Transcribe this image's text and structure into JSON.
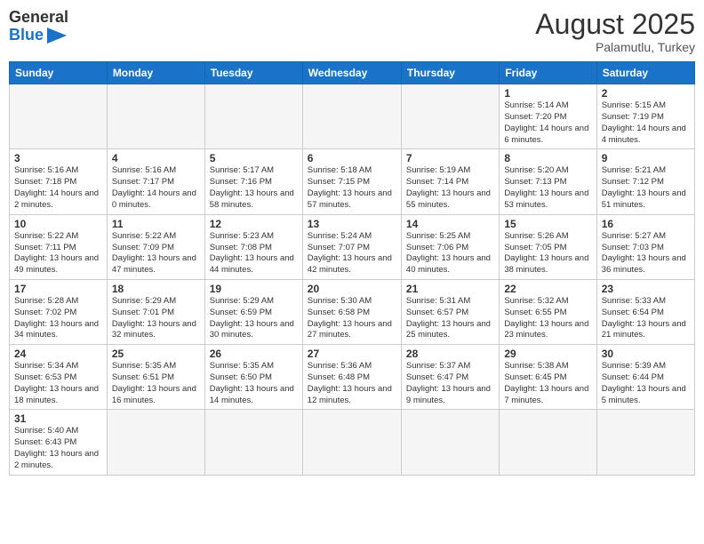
{
  "header": {
    "logo_general": "General",
    "logo_blue": "Blue",
    "month_year": "August 2025",
    "location": "Palamutlu, Turkey"
  },
  "weekdays": [
    "Sunday",
    "Monday",
    "Tuesday",
    "Wednesday",
    "Thursday",
    "Friday",
    "Saturday"
  ],
  "weeks": [
    [
      {
        "day": "",
        "info": ""
      },
      {
        "day": "",
        "info": ""
      },
      {
        "day": "",
        "info": ""
      },
      {
        "day": "",
        "info": ""
      },
      {
        "day": "",
        "info": ""
      },
      {
        "day": "1",
        "info": "Sunrise: 5:14 AM\nSunset: 7:20 PM\nDaylight: 14 hours\nand 6 minutes."
      },
      {
        "day": "2",
        "info": "Sunrise: 5:15 AM\nSunset: 7:19 PM\nDaylight: 14 hours\nand 4 minutes."
      }
    ],
    [
      {
        "day": "3",
        "info": "Sunrise: 5:16 AM\nSunset: 7:18 PM\nDaylight: 14 hours\nand 2 minutes."
      },
      {
        "day": "4",
        "info": "Sunrise: 5:16 AM\nSunset: 7:17 PM\nDaylight: 14 hours\nand 0 minutes."
      },
      {
        "day": "5",
        "info": "Sunrise: 5:17 AM\nSunset: 7:16 PM\nDaylight: 13 hours\nand 58 minutes."
      },
      {
        "day": "6",
        "info": "Sunrise: 5:18 AM\nSunset: 7:15 PM\nDaylight: 13 hours\nand 57 minutes."
      },
      {
        "day": "7",
        "info": "Sunrise: 5:19 AM\nSunset: 7:14 PM\nDaylight: 13 hours\nand 55 minutes."
      },
      {
        "day": "8",
        "info": "Sunrise: 5:20 AM\nSunset: 7:13 PM\nDaylight: 13 hours\nand 53 minutes."
      },
      {
        "day": "9",
        "info": "Sunrise: 5:21 AM\nSunset: 7:12 PM\nDaylight: 13 hours\nand 51 minutes."
      }
    ],
    [
      {
        "day": "10",
        "info": "Sunrise: 5:22 AM\nSunset: 7:11 PM\nDaylight: 13 hours\nand 49 minutes."
      },
      {
        "day": "11",
        "info": "Sunrise: 5:22 AM\nSunset: 7:09 PM\nDaylight: 13 hours\nand 47 minutes."
      },
      {
        "day": "12",
        "info": "Sunrise: 5:23 AM\nSunset: 7:08 PM\nDaylight: 13 hours\nand 44 minutes."
      },
      {
        "day": "13",
        "info": "Sunrise: 5:24 AM\nSunset: 7:07 PM\nDaylight: 13 hours\nand 42 minutes."
      },
      {
        "day": "14",
        "info": "Sunrise: 5:25 AM\nSunset: 7:06 PM\nDaylight: 13 hours\nand 40 minutes."
      },
      {
        "day": "15",
        "info": "Sunrise: 5:26 AM\nSunset: 7:05 PM\nDaylight: 13 hours\nand 38 minutes."
      },
      {
        "day": "16",
        "info": "Sunrise: 5:27 AM\nSunset: 7:03 PM\nDaylight: 13 hours\nand 36 minutes."
      }
    ],
    [
      {
        "day": "17",
        "info": "Sunrise: 5:28 AM\nSunset: 7:02 PM\nDaylight: 13 hours\nand 34 minutes."
      },
      {
        "day": "18",
        "info": "Sunrise: 5:29 AM\nSunset: 7:01 PM\nDaylight: 13 hours\nand 32 minutes."
      },
      {
        "day": "19",
        "info": "Sunrise: 5:29 AM\nSunset: 6:59 PM\nDaylight: 13 hours\nand 30 minutes."
      },
      {
        "day": "20",
        "info": "Sunrise: 5:30 AM\nSunset: 6:58 PM\nDaylight: 13 hours\nand 27 minutes."
      },
      {
        "day": "21",
        "info": "Sunrise: 5:31 AM\nSunset: 6:57 PM\nDaylight: 13 hours\nand 25 minutes."
      },
      {
        "day": "22",
        "info": "Sunrise: 5:32 AM\nSunset: 6:55 PM\nDaylight: 13 hours\nand 23 minutes."
      },
      {
        "day": "23",
        "info": "Sunrise: 5:33 AM\nSunset: 6:54 PM\nDaylight: 13 hours\nand 21 minutes."
      }
    ],
    [
      {
        "day": "24",
        "info": "Sunrise: 5:34 AM\nSunset: 6:53 PM\nDaylight: 13 hours\nand 18 minutes."
      },
      {
        "day": "25",
        "info": "Sunrise: 5:35 AM\nSunset: 6:51 PM\nDaylight: 13 hours\nand 16 minutes."
      },
      {
        "day": "26",
        "info": "Sunrise: 5:35 AM\nSunset: 6:50 PM\nDaylight: 13 hours\nand 14 minutes."
      },
      {
        "day": "27",
        "info": "Sunrise: 5:36 AM\nSunset: 6:48 PM\nDaylight: 13 hours\nand 12 minutes."
      },
      {
        "day": "28",
        "info": "Sunrise: 5:37 AM\nSunset: 6:47 PM\nDaylight: 13 hours\nand 9 minutes."
      },
      {
        "day": "29",
        "info": "Sunrise: 5:38 AM\nSunset: 6:45 PM\nDaylight: 13 hours\nand 7 minutes."
      },
      {
        "day": "30",
        "info": "Sunrise: 5:39 AM\nSunset: 6:44 PM\nDaylight: 13 hours\nand 5 minutes."
      }
    ],
    [
      {
        "day": "31",
        "info": "Sunrise: 5:40 AM\nSunset: 6:43 PM\nDaylight: 13 hours\nand 2 minutes."
      },
      {
        "day": "",
        "info": ""
      },
      {
        "day": "",
        "info": ""
      },
      {
        "day": "",
        "info": ""
      },
      {
        "day": "",
        "info": ""
      },
      {
        "day": "",
        "info": ""
      },
      {
        "day": "",
        "info": ""
      }
    ]
  ]
}
